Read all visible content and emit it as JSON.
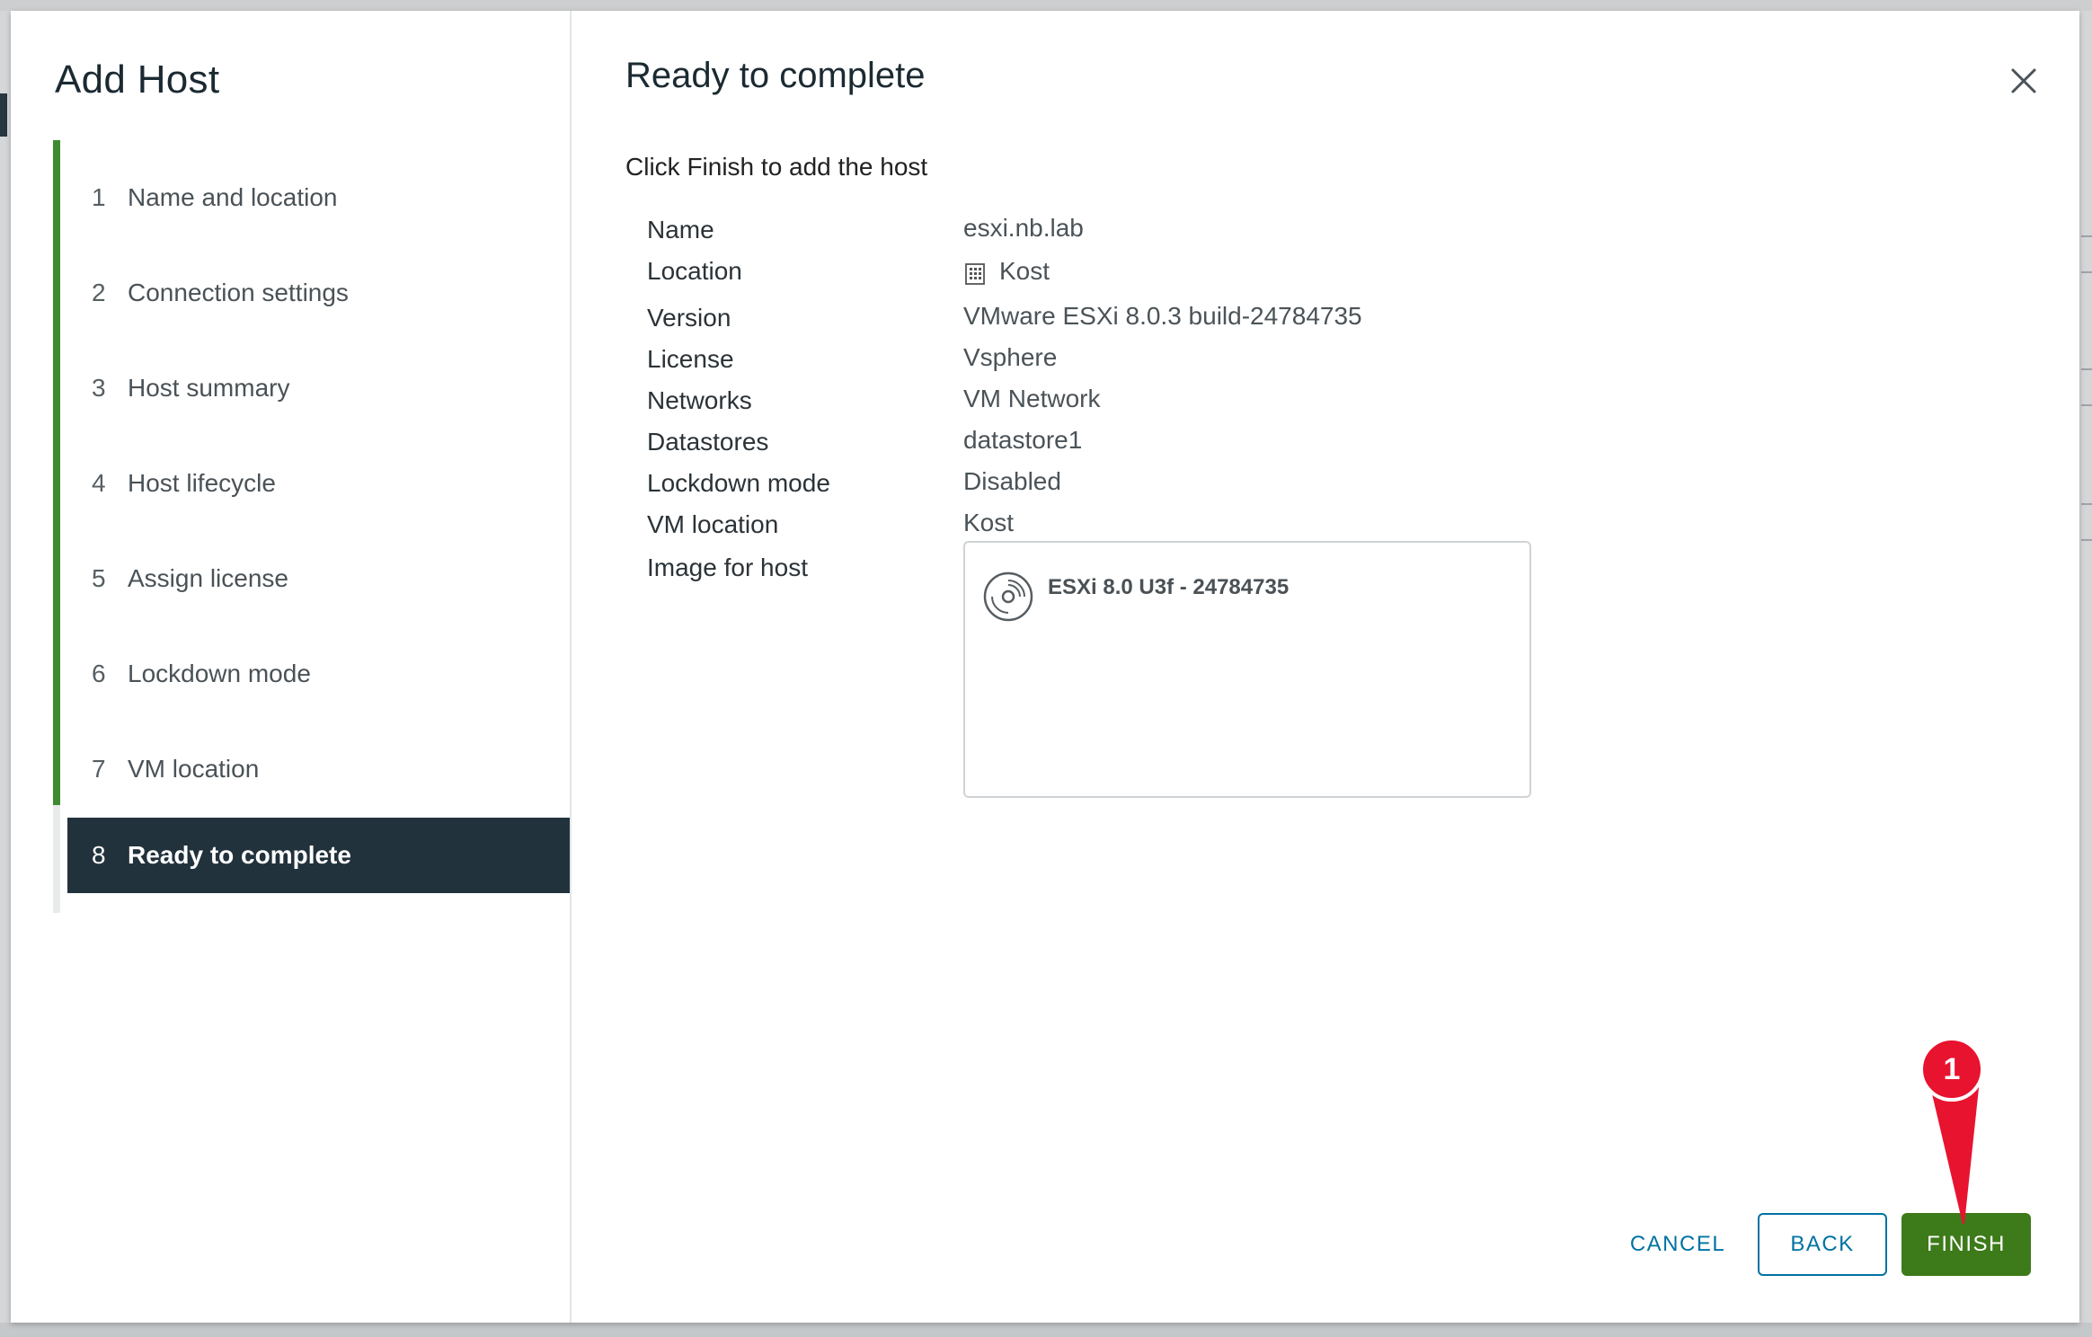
{
  "wizard": {
    "title": "Add Host",
    "steps": [
      {
        "num": "1",
        "label": "Name and location"
      },
      {
        "num": "2",
        "label": "Connection settings"
      },
      {
        "num": "3",
        "label": "Host summary"
      },
      {
        "num": "4",
        "label": "Host lifecycle"
      },
      {
        "num": "5",
        "label": "Assign license"
      },
      {
        "num": "6",
        "label": "Lockdown mode"
      },
      {
        "num": "7",
        "label": "VM location"
      },
      {
        "num": "8",
        "label": "Ready to complete"
      }
    ],
    "active_step": 8
  },
  "page": {
    "title": "Ready to complete",
    "intro": "Click Finish to add the host",
    "close_icon": "close-icon"
  },
  "summary": {
    "name_label": "Name",
    "name_value": "esxi.nb.lab",
    "location_label": "Location",
    "location_value": "Kost",
    "location_icon": "datacenter-icon",
    "version_label": "Version",
    "version_value": "VMware ESXi 8.0.3 build-24784735",
    "license_label": "License",
    "license_value": "Vsphere",
    "networks_label": "Networks",
    "networks_value": "VM Network",
    "datastores_label": "Datastores",
    "datastores_value": "datastore1",
    "lockdown_label": "Lockdown mode",
    "lockdown_value": "Disabled",
    "vmlocation_label": "VM location",
    "vmlocation_value": "Kost",
    "image_label": "Image for host",
    "image_value": "ESXi 8.0 U3f - 24784735",
    "image_icon": "disc-image-icon"
  },
  "buttons": {
    "cancel": "CANCEL",
    "back": "BACK",
    "finish": "FINISH"
  },
  "annotation": {
    "number": "1",
    "color": "#e8132f"
  },
  "colors": {
    "accent_green": "#3d8b2e",
    "finish_green": "#3d7a1a",
    "active_step_bg": "#22323d",
    "link_blue": "#0072a3"
  }
}
